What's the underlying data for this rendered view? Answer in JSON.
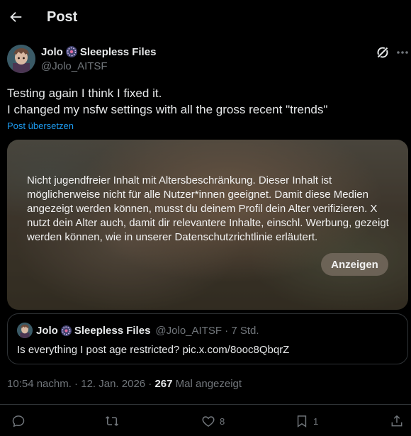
{
  "header": {
    "title": "Post"
  },
  "post": {
    "author_name_part1": "Jolo",
    "author_name_part2": "Sleepless Files",
    "author_handle": "@Jolo_AITSF",
    "text_line1": "Testing again I think I fixed it.",
    "text_line2": "I changed my nsfw settings with all the gross recent \"trends\"",
    "translate_label": "Post übersetzen",
    "media": {
      "warning": "Nicht jugendfreier Inhalt mit Altersbeschränkung. Dieser Inhalt ist möglicherweise nicht für alle Nutzer*innen geeignet. Damit diese Medien angezeigt werden können, musst du deinem Profil dein Alter verifizieren. X nutzt dein Alter auch, damit dir relevantere Inhalte, einschl. Werbung, gezeigt werden können, wie in unserer Datenschutzrichtlinie erläutert.",
      "show_label": "Anzeigen"
    },
    "quote": {
      "name_part1": "Jolo",
      "name_part2": "Sleepless Files",
      "meta": "@Jolo_AITSF · 7 Std.",
      "text": "Is everything I post age restricted? pic.x.com/8ooc8QbqrZ"
    },
    "timestamp": "10:54 nachm. · 12. Jan. 2026 · ",
    "views_count": "267",
    "views_label": " Mal angezeigt",
    "actions": {
      "reply_count": "",
      "repost_count": "",
      "like_count": "8",
      "bookmark_count": "1"
    }
  },
  "icons": {
    "back": "arrow-left-icon",
    "grok": "grok-icon",
    "more": "more-icon",
    "badge": "emblem-icon",
    "reply": "reply-icon",
    "repost": "repost-icon",
    "like": "heart-icon",
    "bookmark": "bookmark-icon",
    "share": "share-icon"
  },
  "colors": {
    "background": "#000000",
    "text": "#e7e9ea",
    "muted": "#71767b",
    "link": "#1d9bf0",
    "border": "#2f3336"
  }
}
